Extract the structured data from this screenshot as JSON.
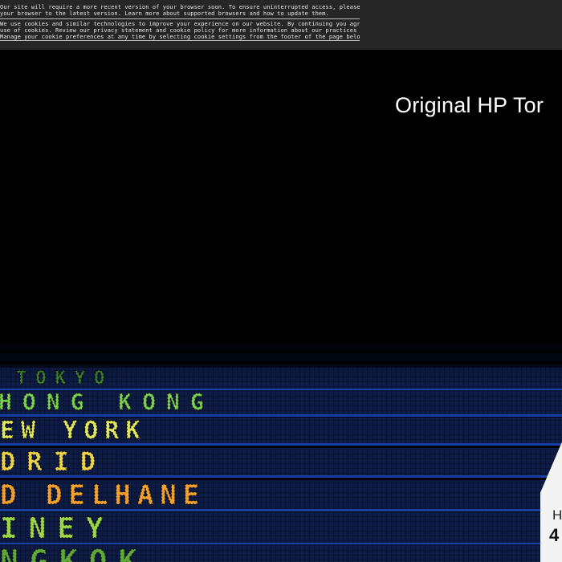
{
  "notice": {
    "lines": [
      "Our site will require a more recent version of your browser soon. To ensure uninterrupted access, please update",
      "your browser to the latest version. Learn more about supported browsers and how to update them.",
      "We use cookies and similar technologies to improve your experience on our website. By continuing you agree to our",
      "use of cookies. Review our privacy statement and cookie policy for more information about our practices here.",
      "Manage your cookie preferences at any time by selecting cookie settings from the footer of the page below."
    ]
  },
  "hero": {
    "title": "Original HP Tor"
  },
  "board": {
    "rows": [
      {
        "text": "TOKYO",
        "color": "#3f8a30"
      },
      {
        "text": "HONG   KONG",
        "color": "#79d050"
      },
      {
        "text": "EW   YORK",
        "color": "#e3e85a"
      },
      {
        "text": "DRID",
        "color": "#ecd24a"
      },
      {
        "text": "D   DELHANE",
        "color": "#f0a030"
      },
      {
        "text": "INEY",
        "color": "#9bd64a"
      },
      {
        "text": "NGKOK",
        "color": "#5ea83a"
      }
    ]
  },
  "card": {
    "label": "H",
    "price": "4"
  }
}
